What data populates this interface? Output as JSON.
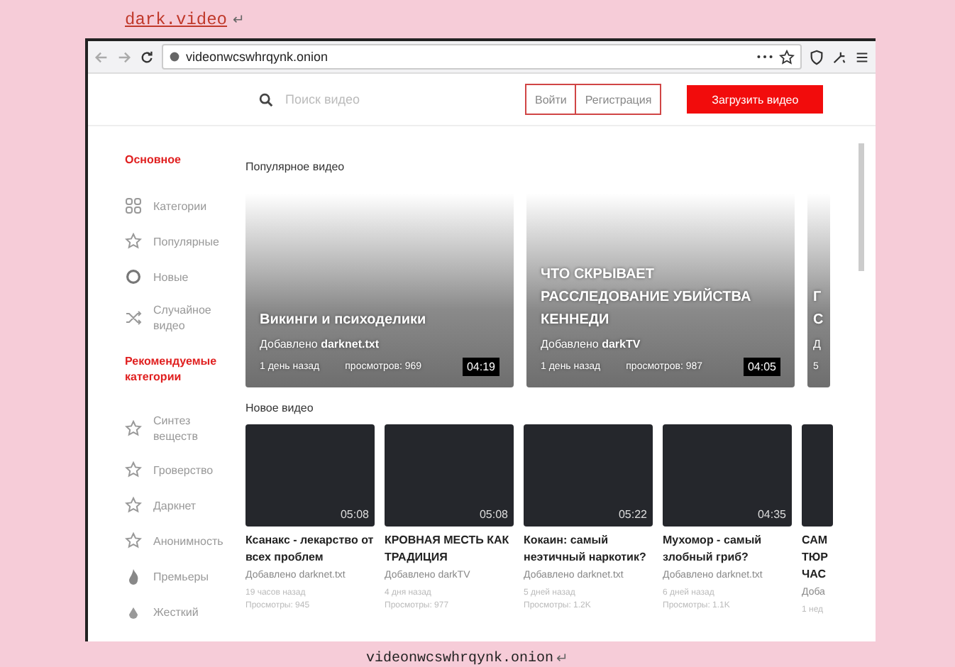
{
  "document": {
    "heading": "dark.video",
    "heading_mark": "↵",
    "caption": "videonwcswhrqynk.onion",
    "caption_mark": "↵"
  },
  "browser": {
    "url": "videonwcswhrqynk.onion"
  },
  "header": {
    "search": {
      "placeholder": "Поиск видео"
    },
    "login": "Войти",
    "register": "Регистрация",
    "upload": "Загрузить видео"
  },
  "sidebar": {
    "sections": [
      {
        "title": "Основное",
        "items": [
          {
            "kind": "grid",
            "label": "Категории"
          },
          {
            "kind": "star",
            "label": "Популярные"
          },
          {
            "kind": "circle",
            "label": "Новые"
          },
          {
            "kind": "shuffle",
            "label": "Случайное видео"
          }
        ]
      },
      {
        "title": "Рекомендуемые категории",
        "items": [
          {
            "kind": "star",
            "label": "Синтез веществ"
          },
          {
            "kind": "star",
            "label": "Гроверство"
          },
          {
            "kind": "star",
            "label": "Даркнет"
          },
          {
            "kind": "star",
            "label": "Анонимность"
          },
          {
            "kind": "fire",
            "label": "Премьеры"
          },
          {
            "kind": "drop",
            "label": "Жесткий"
          }
        ]
      }
    ]
  },
  "popular": {
    "title": "Популярное видео",
    "cards": [
      {
        "title": "Викинги и психоделики",
        "added": "Добавлено **darknet.txt**",
        "age": "1 день назад",
        "views": "просмотров: 969",
        "duration": "04:19"
      },
      {
        "title": "ЧТО СКРЫВАЕТ РАССЛЕДОВАНИЕ УБИЙСТВА КЕННЕДИ",
        "added": "Добавлено **darkTV**",
        "age": "1 день назад",
        "views": "просмотров: 987",
        "duration": "04:05"
      },
      {
        "title": "Г С",
        "added": "Д",
        "age": "5"
      }
    ]
  },
  "new": {
    "title": "Новое видео",
    "cards": [
      {
        "duration": "05:08",
        "title": "Ксанакс - лекарство от всех проблем",
        "added": "Добавлено darknet.txt",
        "age": "19 часов назад",
        "views": "Просмотры: 945"
      },
      {
        "duration": "05:08",
        "title": "КРОВНАЯ МЕСТЬ КАК ТРАДИЦИЯ",
        "added": "Добавлено darkTV",
        "age": "4 дня назад",
        "views": "Просмотры: 977"
      },
      {
        "duration": "05:22",
        "title": "Кокаин: самый неэтичный наркотик?",
        "added": "Добавлено darknet.txt",
        "age": "5 дней назад",
        "views": "Просмотры: 1.2K"
      },
      {
        "duration": "04:35",
        "title": "Мухомор - самый злобный гриб?",
        "added": "Добавлено darknet.txt",
        "age": "6 дней назад",
        "views": "Просмотры: 1.1K"
      },
      {
        "title": "САМ ТЮР ЧАС",
        "added": "Доба",
        "age": "1 нед"
      }
    ]
  }
}
